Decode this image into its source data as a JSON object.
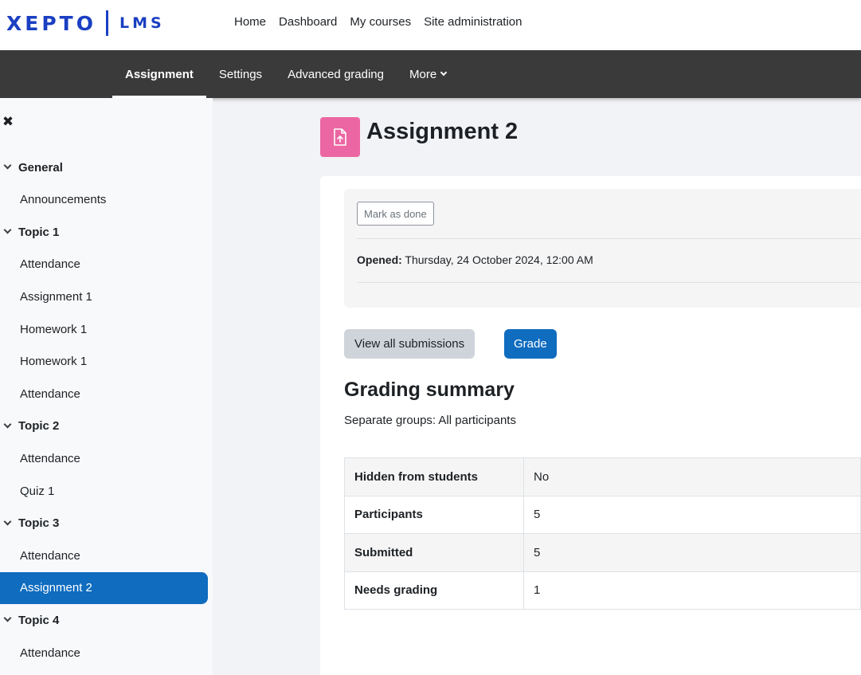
{
  "brand": {
    "name": "XEPTO",
    "product": "LMS"
  },
  "primary_nav": [
    "Home",
    "Dashboard",
    "My courses",
    "Site administration"
  ],
  "secondary_nav": {
    "items": [
      "Assignment",
      "Settings",
      "Advanced grading",
      "More"
    ],
    "active": "Assignment"
  },
  "course_index": {
    "close_icon": "close-icon",
    "items": [
      {
        "label": "General",
        "type": "section"
      },
      {
        "label": "Announcements",
        "type": "activity"
      },
      {
        "label": "Topic 1",
        "type": "section"
      },
      {
        "label": "Attendance",
        "type": "activity"
      },
      {
        "label": "Assignment 1",
        "type": "activity"
      },
      {
        "label": "Homework 1",
        "type": "activity"
      },
      {
        "label": "Homework 1",
        "type": "activity"
      },
      {
        "label": "Attendance",
        "type": "activity"
      },
      {
        "label": "Topic 2",
        "type": "section"
      },
      {
        "label": "Attendance",
        "type": "activity"
      },
      {
        "label": "Quiz 1",
        "type": "activity"
      },
      {
        "label": "Topic 3",
        "type": "section"
      },
      {
        "label": "Attendance",
        "type": "activity"
      },
      {
        "label": "Assignment 2",
        "type": "activity",
        "active": true
      },
      {
        "label": "Topic 4",
        "type": "section"
      },
      {
        "label": "Attendance",
        "type": "activity"
      }
    ]
  },
  "page": {
    "title": "Assignment 2",
    "icon": "assignment-upload-icon",
    "icon_color": "#eb66a2"
  },
  "activity_info": {
    "mark_done_label": "Mark as done",
    "opened_label": "Opened:",
    "opened_value": "Thursday, 24 October 2024, 12:00 AM"
  },
  "actions": {
    "view_submissions_label": "View all submissions",
    "grade_label": "Grade"
  },
  "grading_summary": {
    "title": "Grading summary",
    "group_text": "Separate groups: All participants",
    "rows": [
      {
        "label": "Hidden from students",
        "value": "No"
      },
      {
        "label": "Participants",
        "value": "5"
      },
      {
        "label": "Submitted",
        "value": "5"
      },
      {
        "label": "Needs grading",
        "value": "1"
      }
    ]
  },
  "colors": {
    "primary": "#0f6cbf",
    "brand": "#1a3fc2",
    "secondary_nav_bg": "#3a3a3a"
  }
}
